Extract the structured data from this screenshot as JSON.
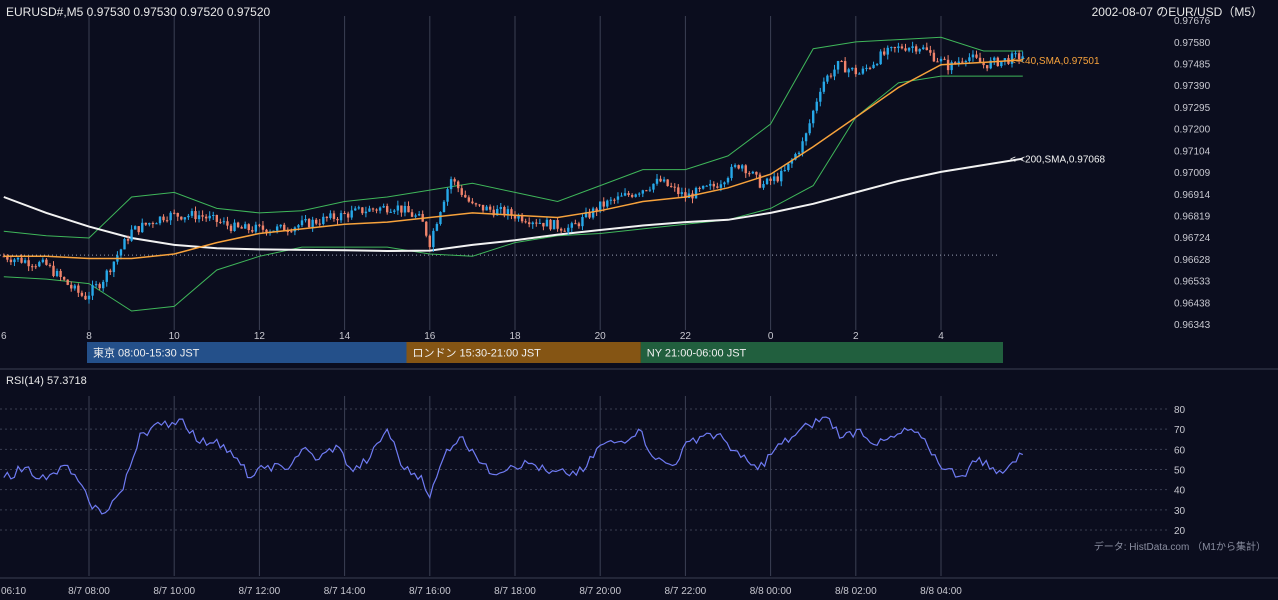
{
  "header": {
    "symbol_ohlc": "EURUSD#,M5 0.97530 0.97530 0.97520 0.97520",
    "date_title": "2002-08-07 のEUR/USD（M5）"
  },
  "colors": {
    "background": "#0b0d1e",
    "grid": "#3b3f53",
    "candle_up": "#27a8e8",
    "candle_down": "#f0836b",
    "sma40": "#f7a23c",
    "sma200": "#f2f2f2",
    "bollinger": "#3fb65a",
    "rsi_line": "#6f7bf3",
    "session_tokyo": "#24508a",
    "session_london": "#855514",
    "session_ny": "#215f3e"
  },
  "chart_data": [
    {
      "type": "candlestick",
      "title": "2002-08-07 のEUR/USD（M5）",
      "ylim": [
        0.96343,
        0.97676
      ],
      "y_ticks": [
        "0.97676",
        "0.97580",
        "0.97485",
        "0.97390",
        "0.97295",
        "0.97200",
        "0.97104",
        "0.97009",
        "0.96914",
        "0.96819",
        "0.96724",
        "0.96628",
        "0.96533",
        "0.96438",
        "0.96343"
      ],
      "x_tick_labels": [
        "6",
        "8",
        "10",
        "12",
        "14",
        "16",
        "18",
        "20",
        "22",
        "0",
        "2",
        "4"
      ],
      "x_range_hours": [
        6.0,
        29.92
      ],
      "reference_line": {
        "value": 0.96645,
        "style": "dotted"
      },
      "annotations": [
        {
          "text": "<-<40,SMA,0.97501",
          "value": 0.97501,
          "color": "#f7a23c"
        },
        {
          "text": "<-<200,SMA,0.97068",
          "value": 0.97068,
          "color": "#f2f2f2"
        }
      ],
      "sma200": [
        [
          6.0,
          0.969
        ],
        [
          7.0,
          0.9683
        ],
        [
          8.0,
          0.9677
        ],
        [
          9.0,
          0.9672
        ],
        [
          10.0,
          0.9669
        ],
        [
          11.0,
          0.96675
        ],
        [
          12.0,
          0.9667
        ],
        [
          13.0,
          0.96668
        ],
        [
          14.0,
          0.96666
        ],
        [
          15.0,
          0.96663
        ],
        [
          16.0,
          0.96665
        ],
        [
          17.0,
          0.9669
        ],
        [
          18.0,
          0.9671
        ],
        [
          19.0,
          0.96735
        ],
        [
          20.0,
          0.96755
        ],
        [
          21.0,
          0.96775
        ],
        [
          22.0,
          0.9679
        ],
        [
          23.0,
          0.968
        ],
        [
          24.0,
          0.9683
        ],
        [
          25.0,
          0.9687
        ],
        [
          26.0,
          0.9692
        ],
        [
          27.0,
          0.9697
        ],
        [
          28.0,
          0.9701
        ],
        [
          29.0,
          0.9704
        ],
        [
          29.92,
          0.97068
        ]
      ],
      "sma40": [
        [
          6.0,
          0.9664
        ],
        [
          7.0,
          0.9664
        ],
        [
          8.0,
          0.9663
        ],
        [
          9.0,
          0.9663
        ],
        [
          10.0,
          0.9665
        ],
        [
          11.0,
          0.967
        ],
        [
          12.0,
          0.9674
        ],
        [
          13.0,
          0.9676
        ],
        [
          14.0,
          0.9678
        ],
        [
          15.0,
          0.9679
        ],
        [
          16.0,
          0.9681
        ],
        [
          17.0,
          0.9683
        ],
        [
          18.0,
          0.9682
        ],
        [
          19.0,
          0.9681
        ],
        [
          20.0,
          0.9684
        ],
        [
          21.0,
          0.9688
        ],
        [
          22.0,
          0.969
        ],
        [
          23.0,
          0.9694
        ],
        [
          24.0,
          0.97
        ],
        [
          25.0,
          0.9712
        ],
        [
          26.0,
          0.9725
        ],
        [
          27.0,
          0.9738
        ],
        [
          28.0,
          0.9748
        ],
        [
          29.0,
          0.9749
        ],
        [
          29.92,
          0.97501
        ]
      ],
      "bb_upper": [
        [
          6.0,
          0.9675
        ],
        [
          7.0,
          0.9673
        ],
        [
          8.0,
          0.9672
        ],
        [
          9.0,
          0.969
        ],
        [
          10.0,
          0.9692
        ],
        [
          11.0,
          0.9685
        ],
        [
          12.0,
          0.9683
        ],
        [
          13.0,
          0.9684
        ],
        [
          14.0,
          0.9688
        ],
        [
          15.0,
          0.969
        ],
        [
          16.0,
          0.9693
        ],
        [
          17.0,
          0.9696
        ],
        [
          18.0,
          0.9692
        ],
        [
          19.0,
          0.9688
        ],
        [
          20.0,
          0.9695
        ],
        [
          21.0,
          0.9702
        ],
        [
          22.0,
          0.9702
        ],
        [
          23.0,
          0.9708
        ],
        [
          24.0,
          0.9722
        ],
        [
          25.0,
          0.9755
        ],
        [
          26.0,
          0.9758
        ],
        [
          27.0,
          0.9759
        ],
        [
          28.0,
          0.976
        ],
        [
          29.0,
          0.9754
        ],
        [
          29.92,
          0.9754
        ]
      ],
      "bb_lower": [
        [
          6.0,
          0.9655
        ],
        [
          7.0,
          0.9654
        ],
        [
          8.0,
          0.9652
        ],
        [
          9.0,
          0.964
        ],
        [
          10.0,
          0.9642
        ],
        [
          11.0,
          0.9658
        ],
        [
          12.0,
          0.9664
        ],
        [
          13.0,
          0.9668
        ],
        [
          14.0,
          0.9668
        ],
        [
          15.0,
          0.9668
        ],
        [
          16.0,
          0.9665
        ],
        [
          17.0,
          0.9664
        ],
        [
          18.0,
          0.967
        ],
        [
          19.0,
          0.9673
        ],
        [
          20.0,
          0.9674
        ],
        [
          21.0,
          0.9676
        ],
        [
          22.0,
          0.9678
        ],
        [
          23.0,
          0.968
        ],
        [
          24.0,
          0.9685
        ],
        [
          25.0,
          0.9695
        ],
        [
          26.0,
          0.9725
        ],
        [
          27.0,
          0.974
        ],
        [
          28.0,
          0.9743
        ],
        [
          29.0,
          0.9743
        ],
        [
          29.92,
          0.9743
        ]
      ],
      "price_path": [
        [
          6.0,
          0.9664
        ],
        [
          7.0,
          0.966
        ],
        [
          7.6,
          0.965
        ],
        [
          7.9,
          0.9646
        ],
        [
          8.3,
          0.9653
        ],
        [
          9.0,
          0.9675
        ],
        [
          9.8,
          0.9682
        ],
        [
          10.6,
          0.9682
        ],
        [
          11.5,
          0.9676
        ],
        [
          12.5,
          0.9676
        ],
        [
          13.5,
          0.968
        ],
        [
          14.4,
          0.9684
        ],
        [
          15.2,
          0.9686
        ],
        [
          15.8,
          0.968
        ],
        [
          16.0,
          0.967
        ],
        [
          16.3,
          0.9688
        ],
        [
          16.5,
          0.9698
        ],
        [
          17.0,
          0.9686
        ],
        [
          17.8,
          0.9683
        ],
        [
          18.6,
          0.9679
        ],
        [
          19.3,
          0.9676
        ],
        [
          20.0,
          0.9686
        ],
        [
          20.8,
          0.9692
        ],
        [
          21.4,
          0.9697
        ],
        [
          22.0,
          0.969
        ],
        [
          22.7,
          0.9695
        ],
        [
          23.3,
          0.9705
        ],
        [
          23.8,
          0.9695
        ],
        [
          24.3,
          0.97
        ],
        [
          24.8,
          0.9715
        ],
        [
          25.2,
          0.974
        ],
        [
          25.6,
          0.9748
        ],
        [
          26.1,
          0.9744
        ],
        [
          26.6,
          0.9752
        ],
        [
          27.1,
          0.9756
        ],
        [
          27.5,
          0.9756
        ],
        [
          27.8,
          0.9752
        ],
        [
          28.2,
          0.9747
        ],
        [
          28.6,
          0.9752
        ],
        [
          29.0,
          0.9748
        ],
        [
          29.5,
          0.975
        ],
        [
          29.92,
          0.9752
        ]
      ],
      "sessions": [
        {
          "label": "東京 08:00-15:30 JST",
          "start_hour": 8.0,
          "end_hour": 15.5
        },
        {
          "label": "ロンドン 15:30-21:00 JST",
          "start_hour": 15.5,
          "end_hour": 21.0
        },
        {
          "label": "NY 21:00-06:00 JST",
          "start_hour": 21.0,
          "end_hour": 30.0
        }
      ]
    },
    {
      "type": "line",
      "title": "RSI(14) 57.3718",
      "ylim": [
        20,
        80
      ],
      "y_ticks": [
        80,
        70,
        60,
        50,
        40,
        30,
        20
      ],
      "x_tick_labels": [
        "06:10",
        "8/7 08:00",
        "8/7 10:00",
        "8/7 12:00",
        "8/7 14:00",
        "8/7 16:00",
        "8/7 18:00",
        "8/7 20:00",
        "8/7 22:00",
        "8/8 00:00",
        "8/8 02:00",
        "8/8 04:00"
      ],
      "series": [
        {
          "name": "RSI(14)",
          "points": [
            [
              6.0,
              46
            ],
            [
              6.5,
              51
            ],
            [
              7.0,
              45
            ],
            [
              7.5,
              52
            ],
            [
              8.0,
              34
            ],
            [
              8.3,
              28
            ],
            [
              8.8,
              40
            ],
            [
              9.2,
              68
            ],
            [
              9.7,
              72
            ],
            [
              10.2,
              75
            ],
            [
              10.6,
              63
            ],
            [
              11.0,
              65
            ],
            [
              11.4,
              56
            ],
            [
              11.8,
              46
            ],
            [
              12.2,
              52
            ],
            [
              12.6,
              50
            ],
            [
              13.0,
              60
            ],
            [
              13.4,
              55
            ],
            [
              13.8,
              62
            ],
            [
              14.2,
              49
            ],
            [
              14.6,
              56
            ],
            [
              15.0,
              70
            ],
            [
              15.4,
              50
            ],
            [
              15.8,
              47
            ],
            [
              16.0,
              36
            ],
            [
              16.4,
              60
            ],
            [
              16.7,
              66
            ],
            [
              17.0,
              60
            ],
            [
              17.4,
              48
            ],
            [
              17.9,
              52
            ],
            [
              18.4,
              53
            ],
            [
              18.8,
              48
            ],
            [
              19.2,
              48
            ],
            [
              19.6,
              49
            ],
            [
              20.0,
              62
            ],
            [
              20.5,
              64
            ],
            [
              20.9,
              70
            ],
            [
              21.3,
              55
            ],
            [
              21.7,
              52
            ],
            [
              22.1,
              64
            ],
            [
              22.5,
              68
            ],
            [
              22.9,
              65
            ],
            [
              23.3,
              56
            ],
            [
              23.7,
              50
            ],
            [
              24.1,
              60
            ],
            [
              24.5,
              66
            ],
            [
              24.9,
              72
            ],
            [
              25.3,
              76
            ],
            [
              25.7,
              66
            ],
            [
              26.1,
              70
            ],
            [
              26.5,
              62
            ],
            [
              26.9,
              66
            ],
            [
              27.3,
              70
            ],
            [
              27.7,
              61
            ],
            [
              28.1,
              50
            ],
            [
              28.5,
              47
            ],
            [
              28.9,
              56
            ],
            [
              29.3,
              48
            ],
            [
              29.6,
              52
            ],
            [
              29.92,
              57.37
            ]
          ]
        }
      ]
    }
  ],
  "footer_credit": "データ: HistData.com （M1から集計）"
}
